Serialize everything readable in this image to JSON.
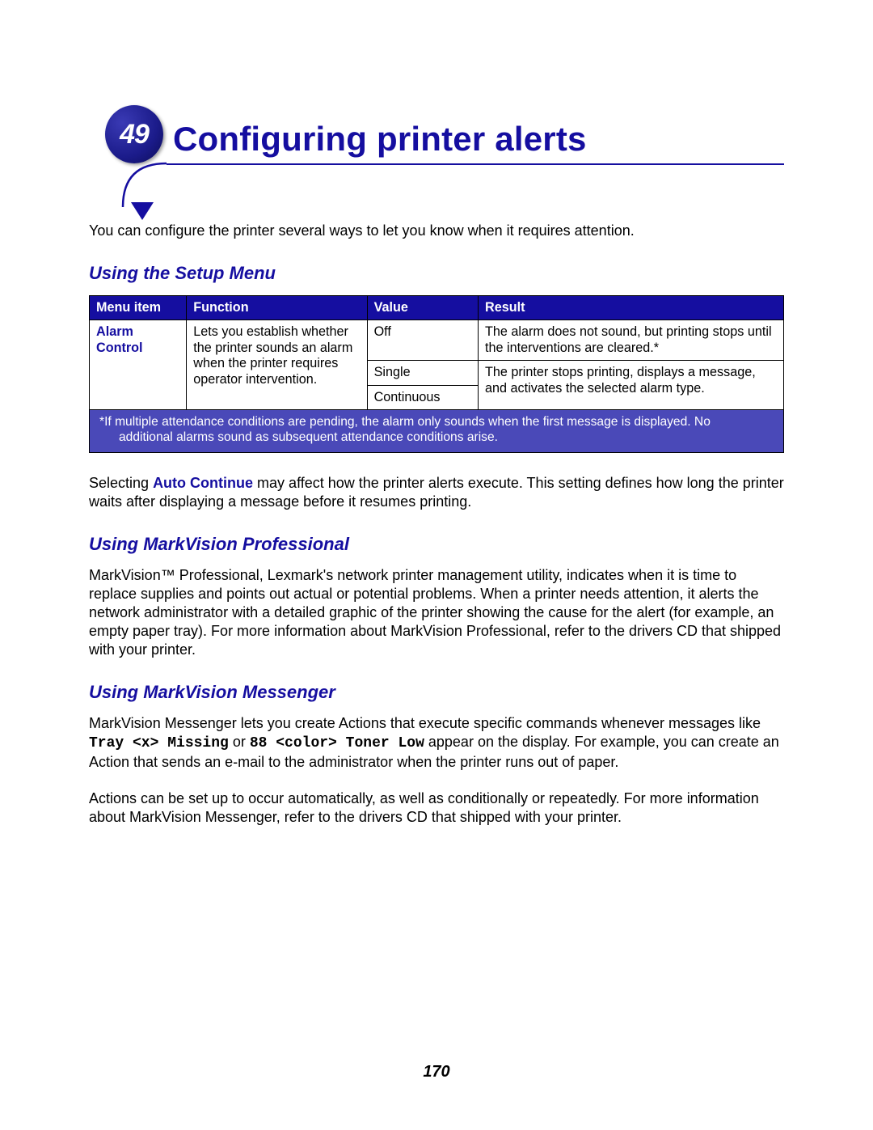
{
  "chapter": {
    "number": "49",
    "title": "Configuring printer alerts"
  },
  "intro": "You can configure the printer several ways to let you know when it requires attention.",
  "section1": {
    "heading": "Using the Setup Menu",
    "table": {
      "headers": {
        "menu": "Menu item",
        "func": "Function",
        "value": "Value",
        "result": "Result"
      },
      "menu_item": "Alarm Control",
      "func": "Lets you establish whether the printer sounds an alarm when the printer requires operator intervention.",
      "rows": [
        {
          "value": "Off",
          "result": "The alarm does not sound, but printing stops until the interventions are cleared.*"
        },
        {
          "value": "Single",
          "result": "The printer stops printing, displays a message, and activates the selected alarm type."
        },
        {
          "value": "Continuous",
          "result": ""
        }
      ],
      "footnote_line1": "*If multiple attendance conditions are pending, the alarm only sounds when the first message is displayed. No",
      "footnote_line2": "additional alarms sound as subsequent attendance conditions arise."
    },
    "afterTable": {
      "pre": "Selecting ",
      "bold": "Auto Continue",
      "post": " may affect how the printer alerts execute. This setting defines how long the printer waits after displaying a message before it resumes printing."
    }
  },
  "section2": {
    "heading": "Using MarkVision Professional",
    "para": "MarkVision™ Professional, Lexmark's network printer management utility, indicates when it is time to replace supplies and points out actual or potential problems. When a printer needs attention, it alerts the network administrator with a detailed graphic of the printer showing the cause for the alert (for example, an empty paper tray). For more information about MarkVision Professional, refer to the drivers CD that shipped with your printer."
  },
  "section3": {
    "heading": "Using MarkVision Messenger",
    "para1": {
      "a": "MarkVision Messenger lets you create Actions that execute specific commands whenever messages like ",
      "code1": "Tray <x> Missing",
      "mid": " or ",
      "code2": "88 <color> Toner Low",
      "b": " appear on the display. For example, you can create an Action that sends an e-mail to the administrator when the printer runs out of paper."
    },
    "para2": "Actions can be set up to occur automatically, as well as conditionally or repeatedly. For more information about MarkVision Messenger, refer to the drivers CD that shipped with your printer."
  },
  "pageNumber": "170"
}
